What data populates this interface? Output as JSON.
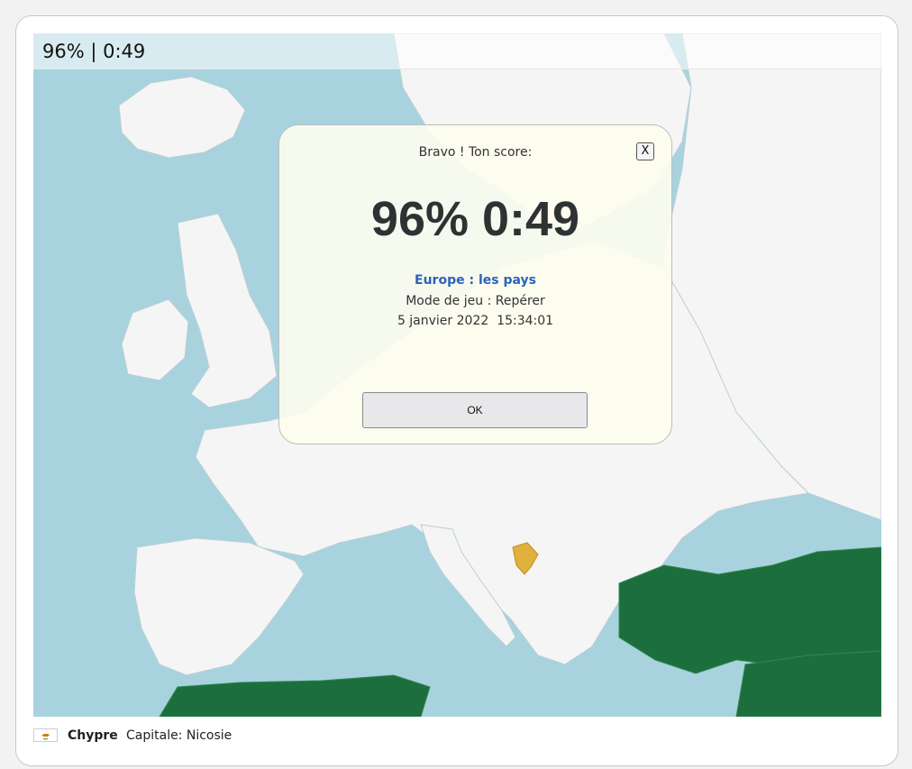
{
  "score_bar": {
    "text": "96% | 0:49"
  },
  "modal": {
    "title": "Bravo ! Ton score:",
    "close_label": "X",
    "score": "96% 0:49",
    "quiz_name": "Europe : les pays",
    "mode": "Mode de jeu : Repérer",
    "date": "5 janvier 2022  15:34:01",
    "ok_label": "OK"
  },
  "footer": {
    "country": "Chypre",
    "capital": "Capitale: Nicosie",
    "flag_icon": "cyprus-flag-icon"
  },
  "colors": {
    "sea": "#a8d3de",
    "land": "#f5f5f5",
    "highlight": "#e0b13c",
    "other_land": "#1c6e3d",
    "link": "#2b63b8"
  }
}
